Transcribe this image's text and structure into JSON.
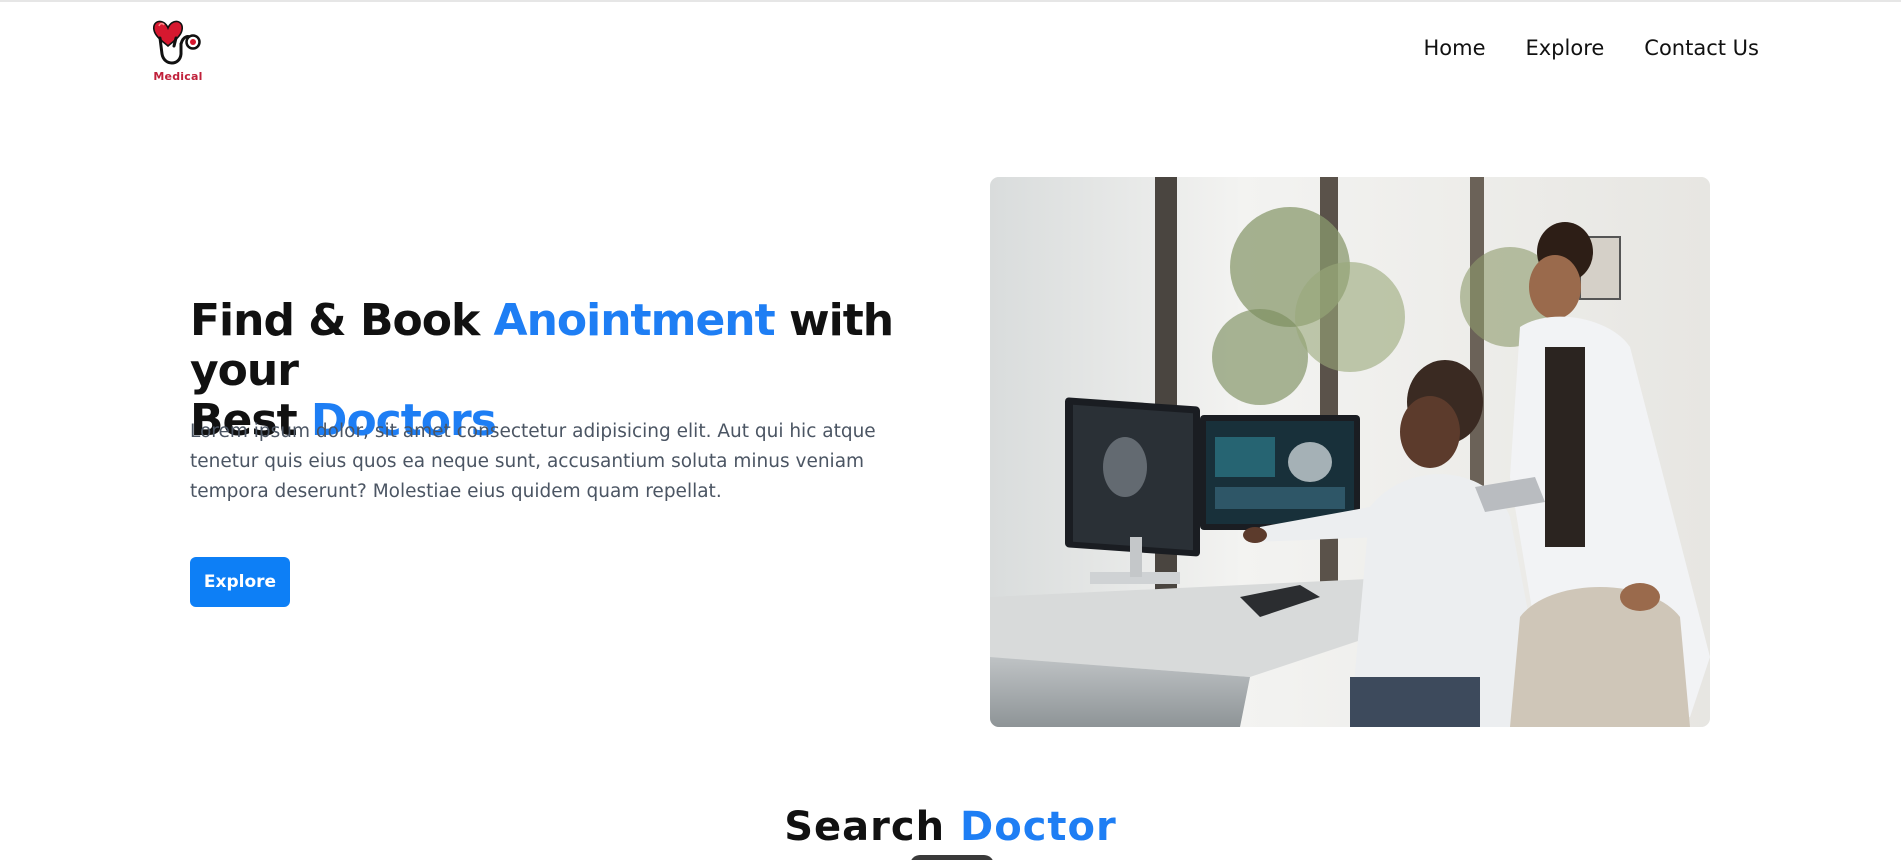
{
  "brand": {
    "logo_text": "Medical"
  },
  "nav": {
    "home": "Home",
    "explore": "Explore",
    "contact": "Contact Us"
  },
  "hero": {
    "title_part1": "Find & Book ",
    "title_accent1": "Anointment",
    "title_part2": " with your",
    "title_part3": "Best ",
    "title_accent2": "Doctors",
    "description": "Lorem ipsum dolor, sit amet consectetur adipisicing elit. Aut qui hic atque tenetur quis eius quos ea neque sunt, accusantium soluta minus veniam tempora deserunt? Molestiae eius quidem quam repellat.",
    "button_label": "Explore"
  },
  "search": {
    "title_part1": "Search ",
    "title_accent": "Doctor"
  },
  "colors": {
    "accent": "#1e7ef4",
    "button": "#0d7ff6",
    "logo_red": "#c0203a"
  }
}
